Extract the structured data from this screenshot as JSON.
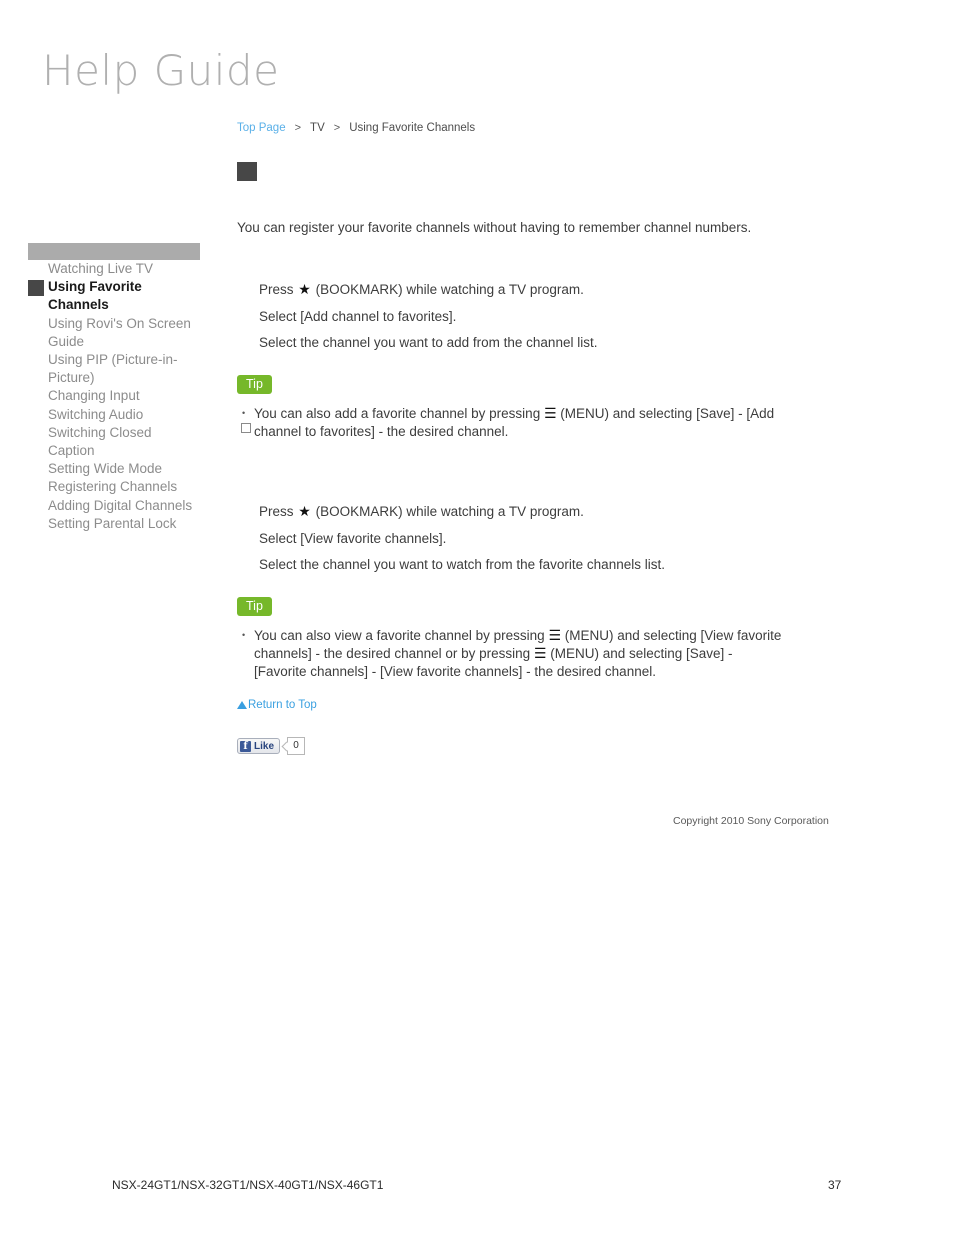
{
  "site": {
    "logo_text": "Help Guide"
  },
  "breadcrumb": {
    "top_page": "Top Page",
    "separator_1": ">",
    "section": "TV",
    "separator_2": ">",
    "current": "Using Favorite Channels"
  },
  "sidebar": {
    "items": [
      {
        "label": "Watching Live TV",
        "active": false
      },
      {
        "label": "Using Favorite Channels",
        "active": true
      },
      {
        "label": "Using Rovi's On Screen Guide",
        "active": false
      },
      {
        "label": "Using PIP (Picture-in-Picture)",
        "active": false
      },
      {
        "label": "Changing Input",
        "active": false
      },
      {
        "label": "Switching Audio",
        "active": false
      },
      {
        "label": "Switching Closed Caption",
        "active": false
      },
      {
        "label": "Setting Wide Mode",
        "active": false
      },
      {
        "label": "Registering Channels",
        "active": false
      },
      {
        "label": "Adding Digital Channels",
        "active": false
      },
      {
        "label": "Setting Parental Lock",
        "active": false
      }
    ]
  },
  "main": {
    "intro": "You can register your favorite channels without having to remember channel numbers.",
    "section_add": {
      "step_1_prefix": "Press ",
      "step_1_icon": "star-icon",
      "step_1_suffix": " (BOOKMARK) while watching a TV program.",
      "step_2": "Select [Add channel to favorites].",
      "step_3": "Select the channel you want to add from the channel list."
    },
    "tip_add": {
      "badge": "Tip",
      "text_part_1": "You can also add a favorite channel by pressing ",
      "menu_icon": "menu-icon",
      "text_part_2": " (MENU) and selecting [Save] - [Add channel to favorites] - the desired channel."
    },
    "section_view": {
      "step_1_prefix": "Press ",
      "step_1_icon": "star-icon",
      "step_1_suffix": " (BOOKMARK) while watching a TV program.",
      "step_2": "Select [View favorite channels].",
      "step_3": "Select the channel you want to watch from the favorite channels list."
    },
    "tip_view": {
      "badge": "Tip",
      "text_part_1": "You can also view a favorite channel by pressing ",
      "menu_icon_1": "menu-icon",
      "text_part_2": " (MENU) and selecting [View favorite channels] - the desired channel or by pressing ",
      "menu_icon_2": "menu-icon",
      "text_part_3": " (MENU) and selecting [Save] - [Favorite channels] - [View favorite channels] - the desired channel."
    },
    "return_to_top": "Return to Top",
    "social": {
      "like_label": "Like",
      "like_count": "0"
    },
    "copyright": "Copyright 2010 Sony Corporation"
  },
  "page_footer": {
    "models": "NSX-24GT1/NSX-32GT1/NSX-40GT1/NSX-46GT1",
    "page_number": "37"
  },
  "colors": {
    "link_blue": "#5ab0e8",
    "tip_green": "#76b82a",
    "sidebar_header_gray": "#ababab",
    "marker_dark": "#474747",
    "facebook_blue": "#3b5998"
  }
}
